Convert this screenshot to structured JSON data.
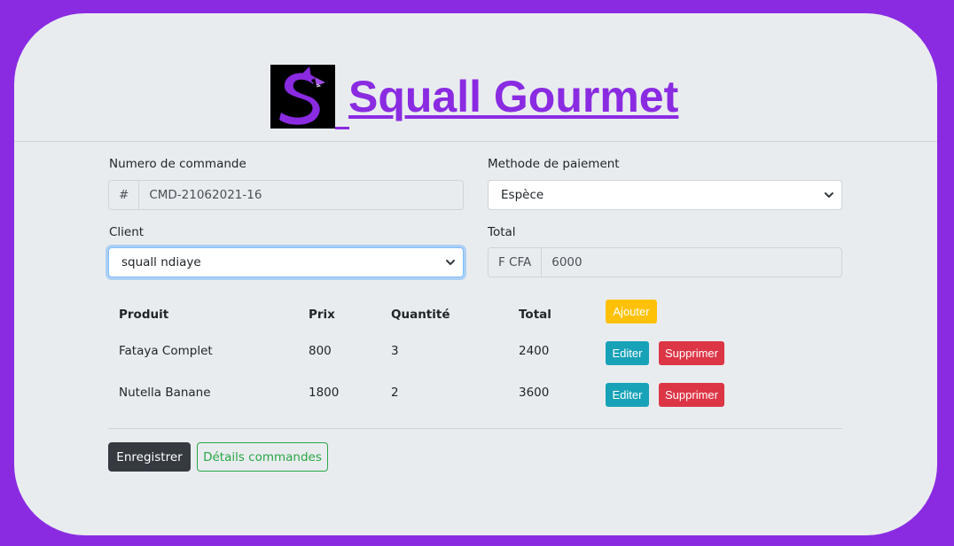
{
  "header": {
    "brand_name": " Squall Gourmet",
    "logo_icon": "shark-s-logo-icon",
    "brand_color": "#8a2be2"
  },
  "form": {
    "order_number": {
      "label": "Numero de commande",
      "prefix": "#",
      "value": "CMD-21062021-16"
    },
    "payment_method": {
      "label": "Methode de paiement",
      "selected": "Espèce"
    },
    "client": {
      "label": "Client",
      "selected": "squall ndiaye"
    },
    "total": {
      "label": "Total",
      "prefix": "F CFA",
      "value": "6000"
    }
  },
  "table": {
    "headers": {
      "product": "Produit",
      "price": "Prix",
      "quantity": "Quantité",
      "total": "Total"
    },
    "add_label": "Ajouter",
    "rows": [
      {
        "product": "Fataya Complet",
        "price": "800",
        "quantity": "3",
        "total": "2400",
        "edit_label": "Editer",
        "delete_label": "Supprimer"
      },
      {
        "product": "Nutella Banane",
        "price": "1800",
        "quantity": "2",
        "total": "3600",
        "edit_label": "Editer",
        "delete_label": "Supprimer"
      }
    ]
  },
  "actions": {
    "save_label": "Enregistrer",
    "details_label": "Détails commandes"
  },
  "colors": {
    "background": "#8a2be2",
    "card": "#e9ecef",
    "warning": "#ffc107",
    "info": "#17a2b8",
    "danger": "#dc3545",
    "dark": "#343a40",
    "success": "#28a745"
  }
}
